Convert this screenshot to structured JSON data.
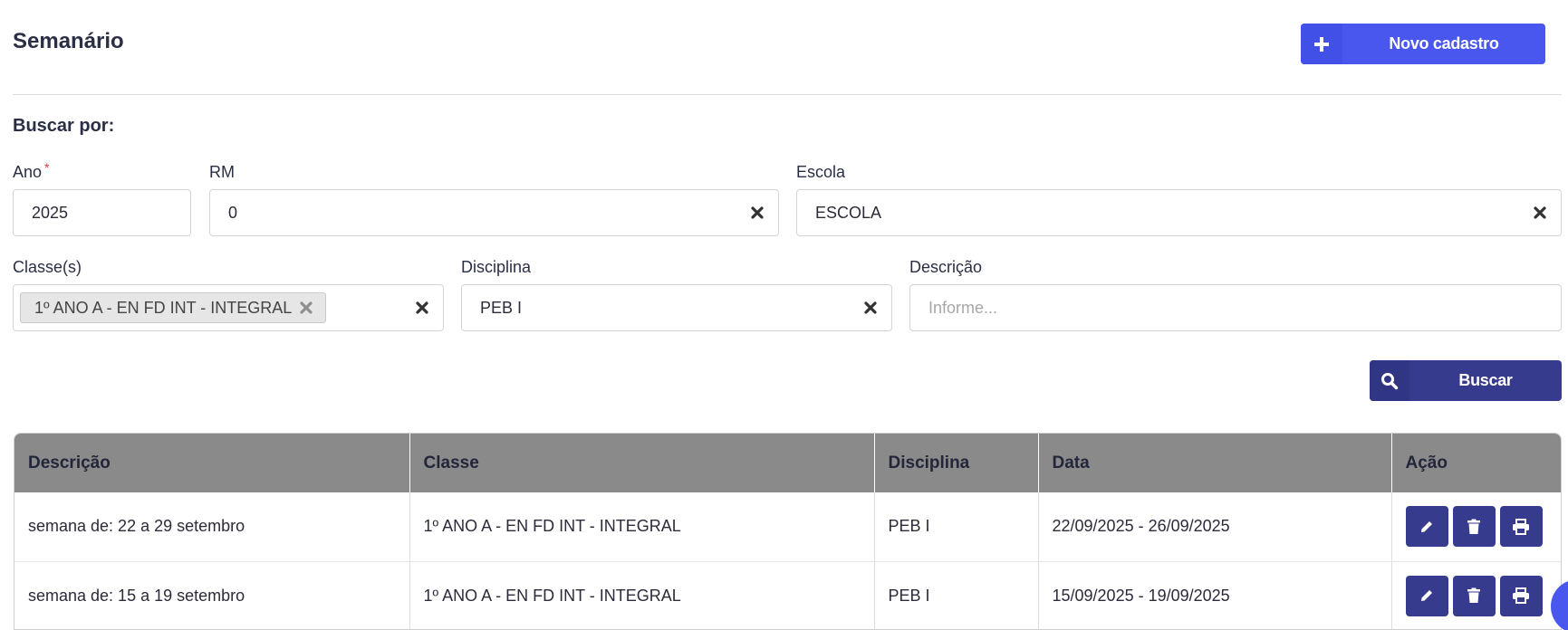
{
  "header": {
    "title": "Semanário",
    "new_button_label": "Novo cadastro"
  },
  "search": {
    "heading": "Buscar por:",
    "ano": {
      "label": "Ano",
      "required_mark": "*",
      "value": "2025"
    },
    "rm": {
      "label": "RM",
      "value": "0"
    },
    "escola": {
      "label": "Escola",
      "value": "ESCOLA"
    },
    "classes": {
      "label": "Classe(s)",
      "tags": [
        "1º ANO A - EN FD INT - INTEGRAL"
      ]
    },
    "disciplina": {
      "label": "Disciplina",
      "value": "PEB I"
    },
    "descricao": {
      "label": "Descrição",
      "placeholder": "Informe..."
    },
    "search_button_label": "Buscar"
  },
  "table": {
    "columns": [
      "Descrição",
      "Classe",
      "Disciplina",
      "Data",
      "Ação"
    ],
    "rows": [
      {
        "descricao": "semana de: 22 a 29 setembro",
        "classe": "1º ANO A - EN FD INT - INTEGRAL",
        "disciplina": "PEB I",
        "data": "22/09/2025 - 26/09/2025"
      },
      {
        "descricao": "semana de: 15 a 19 setembro",
        "classe": "1º ANO A - EN FD INT - INTEGRAL",
        "disciplina": "PEB I",
        "data": "15/09/2025 - 19/09/2025"
      }
    ]
  },
  "icons": {
    "new": "plus-icon",
    "search": "search-icon",
    "clear": "close-icon",
    "edit": "pencil-icon",
    "delete": "trash-icon",
    "print": "printer-icon"
  },
  "colors": {
    "primary": "#4a57ee",
    "dark_primary": "#363b8e",
    "table_header": "#8a8a8a",
    "required": "#e53935"
  }
}
